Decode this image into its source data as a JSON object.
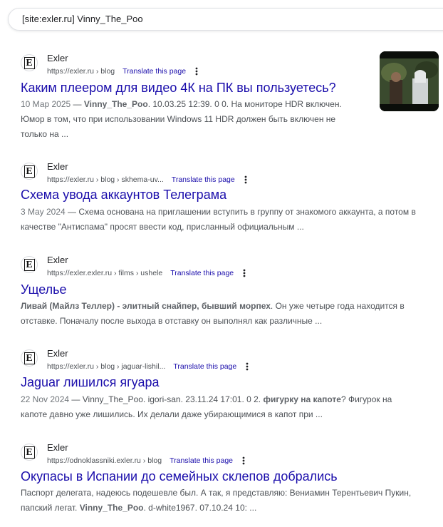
{
  "search": {
    "query": "[site:exler.ru] Vinny_The_Poo"
  },
  "results": [
    {
      "site": "Exler",
      "url": "https://exler.ru › blog",
      "translate": "Translate this page",
      "title": "Каким плеером для видео 4К на ПК вы пользуетесь?",
      "date": "10 Мар 2025",
      "sep": " — ",
      "bold": "Vinny_The_Poo",
      "rest1": ". 10.03.25 12:39. 0 0. На мониторе HDR включен.",
      "line2": "Юмор в том, что при использовании Windows 11 HDR должен быть включен не",
      "line3": "только на ..."
    },
    {
      "site": "Exler",
      "url": "https://exler.ru › blog › skhema-uv...",
      "translate": "Translate this page",
      "title": "Схема увода аккаунтов Телеграма",
      "date": "3 May 2024",
      "sep": " — ",
      "rest1": "Схема основана на приглашении вступить в группу от знакомого аккаунта, а потом в",
      "line2": "качестве \"Антиспама\" просят ввести код, присланный официальным ..."
    },
    {
      "site": "Exler",
      "url": "https://exler.exler.ru › films › ushele",
      "translate": "Translate this page",
      "title": "Ущелье",
      "bold": "Ливай (Майлз Теллер) - элитный снайпер, бывший морпех",
      "rest1": ". Он уже четыре года находится в",
      "line2": "отставке. Поначалу после выхода в отставку он выполнял как различные ..."
    },
    {
      "site": "Exler",
      "url": "https://exler.ru › blog › jaguar-lishil...",
      "translate": "Translate this page",
      "title": "Jaguar лишился ягуара",
      "date": "22 Nov 2024",
      "sep": " — ",
      "rest1a": "Vinny_The_Poo. igori-san. 23.11.24 17:01. 0 2. ",
      "bold": "фигурку на капоте",
      "rest1b": "? Фигурок на",
      "line2": "капоте давно уже лишились. Их делали даже убирающимися в капот при ..."
    },
    {
      "site": "Exler",
      "url": "https://odnoklassniki.exler.ru › blog",
      "translate": "Translate this page",
      "title": "Окупасы в Испании до семейных склепов добрались",
      "line1": "Паспорт делегата, надеюсь подешевле был. А так, я представляю: Вениамин Терентьевич Пукин,",
      "line2a": "папский легат. ",
      "bold": "Vinny_The_Poo",
      "line2b": ". d-white1967. 07.10.24 10: ..."
    }
  ],
  "colors": {
    "link": "#1a0dab",
    "text": "#202124",
    "snippet": "#4d5156",
    "border": "#dfe1e5"
  },
  "icons": {
    "favicon": "exler-e-favicon",
    "more": "more-vert-icon"
  }
}
